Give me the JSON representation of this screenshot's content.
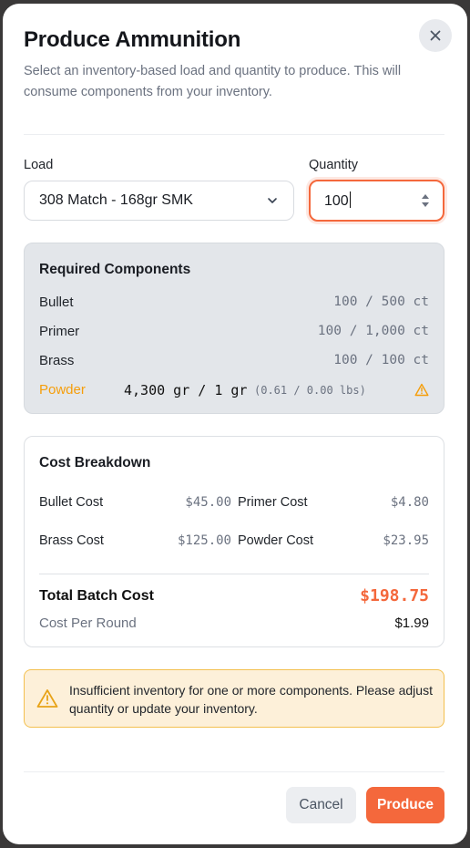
{
  "dialog": {
    "title": "Produce Ammunition",
    "subtitle": "Select an inventory-based load and quantity to produce. This will consume components from your inventory.",
    "close_icon": "close-icon"
  },
  "form": {
    "load_label": "Load",
    "load_value": "308 Match - 168gr SMK",
    "quantity_label": "Quantity",
    "quantity_value": "100"
  },
  "required": {
    "title": "Required Components",
    "rows": [
      {
        "name": "Bullet",
        "value": "100 / 500 ct"
      },
      {
        "name": "Primer",
        "value": "100 / 1,000 ct"
      },
      {
        "name": "Brass",
        "value": "100 / 100 ct"
      }
    ],
    "powder": {
      "name": "Powder",
      "value": "4,300 gr / 1 gr",
      "lbs": "(0.61 / 0.00 lbs)",
      "icon": "warning-icon"
    }
  },
  "cost": {
    "title": "Cost Breakdown",
    "bullet_label": "Bullet Cost",
    "bullet_value": "$45.00",
    "primer_label": "Primer Cost",
    "primer_value": "$4.80",
    "brass_label": "Brass Cost",
    "brass_value": "$125.00",
    "powder_label": "Powder Cost",
    "powder_value": "$23.95",
    "total_label": "Total Batch Cost",
    "total_value": "$198.75",
    "per_round_label": "Cost Per Round",
    "per_round_value": "$1.99"
  },
  "alert": {
    "text": "Insufficient inventory for one or more components. Please adjust quantity or update your inventory.",
    "icon": "warning-icon"
  },
  "actions": {
    "cancel": "Cancel",
    "produce": "Produce"
  },
  "colors": {
    "accent": "#f4683c",
    "warning": "#f59e0b",
    "alert_bg": "#fdf0d9"
  }
}
